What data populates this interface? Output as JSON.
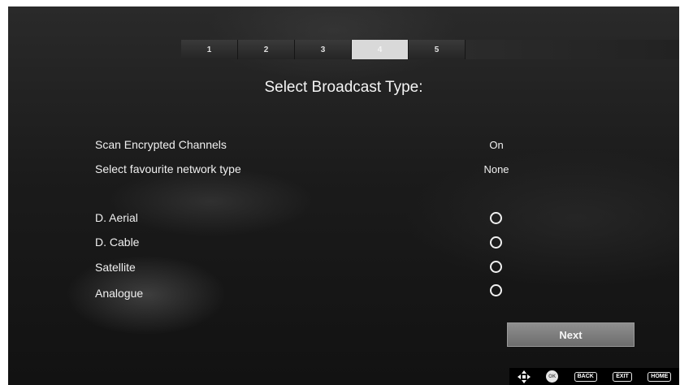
{
  "stepper": {
    "steps": [
      "1",
      "2",
      "3",
      "4",
      "5"
    ],
    "active_step": "4"
  },
  "title": "Select Broadcast Type:",
  "settings": [
    {
      "label": "Scan Encrypted Channels",
      "value": "On"
    },
    {
      "label": "Select favourite network type",
      "value": "None"
    }
  ],
  "broadcast_types": [
    {
      "label": "D. Aerial",
      "selected": false
    },
    {
      "label": "D. Cable",
      "selected": false
    },
    {
      "label": "Satellite",
      "selected": false
    },
    {
      "label": "Analogue",
      "selected": false
    }
  ],
  "next_label": "Next",
  "hints": {
    "ok": "OK",
    "back": "BACK",
    "exit": "EXIT",
    "home": "HOME",
    "icons": [
      "dpad-icon",
      "ok-icon"
    ]
  }
}
